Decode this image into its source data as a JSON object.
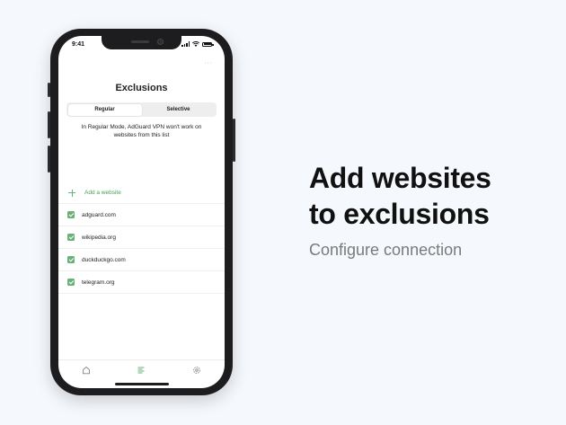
{
  "status_bar": {
    "time": "9:41"
  },
  "screen": {
    "more": "···",
    "title": "Exclusions",
    "segments": [
      "Regular",
      "Selective"
    ],
    "active_segment": "Regular",
    "description": "In Regular Mode, AdGuard VPN won't work on websites from this list",
    "add_label": "Add a website",
    "websites": [
      "adguard.com",
      "wikipedia.org",
      "duckduckgo.com",
      "telegram.org"
    ],
    "tabs": [
      {
        "icon": "home-icon"
      },
      {
        "icon": "exclusions-list-icon",
        "active": true
      },
      {
        "icon": "gear-icon"
      }
    ]
  },
  "promo": {
    "headline_line1": "Add websites",
    "headline_line2": "to exclusions",
    "subheadline": "Configure connection"
  },
  "colors": {
    "accent": "#67b279",
    "background": "#f5f8fc"
  }
}
